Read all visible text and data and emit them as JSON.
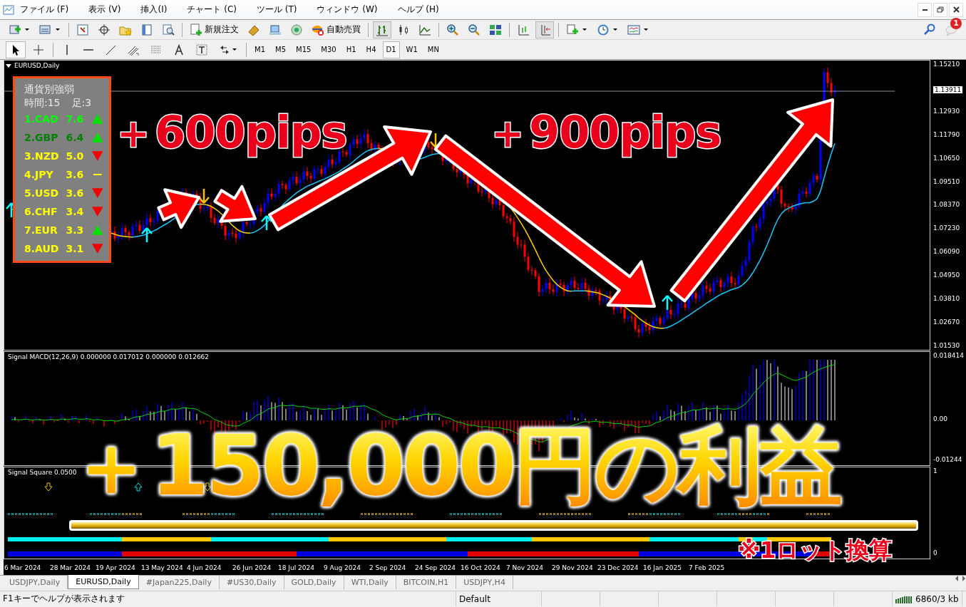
{
  "menu": {
    "items": [
      "ファイル (F)",
      "表示 (V)",
      "挿入(I)",
      "チャート (C)",
      "ツール (T)",
      "ウィンドウ (W)",
      "ヘルプ (H)"
    ]
  },
  "toolbar": {
    "buttons": [
      {
        "label": "新規注文"
      },
      {
        "label": "自動売買"
      }
    ],
    "bar_chart_on": true,
    "autoscroll_on": true,
    "notification_count": "1"
  },
  "drawing_tools": {
    "cursor_selected": true,
    "timeframes": [
      {
        "label": "M1",
        "selected": false
      },
      {
        "label": "M5",
        "selected": false
      },
      {
        "label": "M15",
        "selected": false
      },
      {
        "label": "M30",
        "selected": false
      },
      {
        "label": "H1",
        "selected": false
      },
      {
        "label": "H4",
        "selected": false
      },
      {
        "label": "D1",
        "selected": true
      },
      {
        "label": "W1",
        "selected": false
      },
      {
        "label": "MN",
        "selected": false
      }
    ]
  },
  "chart": {
    "title": "EURUSD,Daily",
    "price_axis": [
      "1.15210",
      "1.12930",
      "1.11790",
      "1.10650",
      "1.09510",
      "1.08370",
      "1.07230",
      "1.06090",
      "1.04950",
      "1.03810",
      "1.02670",
      "1.01530"
    ],
    "current_price": "1.13911",
    "strength": {
      "title": "通貨別強弱",
      "period": "時間:15",
      "bars": "足:3",
      "rows": [
        {
          "label": "1.CAD",
          "value": "7.6",
          "color": "#00ff00",
          "trend": {
            "kind": "up",
            "color": "#00e000"
          }
        },
        {
          "label": "2.GBP",
          "value": "6.4",
          "color": "#008000",
          "trend": {
            "kind": "up",
            "color": "#00e000"
          }
        },
        {
          "label": "3.NZD",
          "value": "5.0",
          "color": "#ffff00",
          "trend": {
            "kind": "down",
            "color": "#f00000"
          }
        },
        {
          "label": "4.JPY",
          "value": "3.6",
          "color": "#ffff00",
          "trend": {
            "kind": "flat",
            "color": "#ffff00"
          }
        },
        {
          "label": "5.USD",
          "value": "3.6",
          "color": "#ffff00",
          "trend": {
            "kind": "down",
            "color": "#f00000"
          }
        },
        {
          "label": "6.CHF",
          "value": "3.4",
          "color": "#ffff00",
          "trend": {
            "kind": "down",
            "color": "#f00000"
          }
        },
        {
          "label": "7.EUR",
          "value": "3.3",
          "color": "#ffff00",
          "trend": {
            "kind": "up",
            "color": "#00e000"
          }
        },
        {
          "label": "8.AUD",
          "value": "3.1",
          "color": "#ffff00",
          "trend": {
            "kind": "down",
            "color": "#f00000"
          }
        }
      ]
    }
  },
  "macd": {
    "label": "Signal MACD(12,26,9) 0.000000 0.017012 0.000000 0.012662",
    "axis": [
      "0.018414",
      "0.00",
      "-0.01244"
    ]
  },
  "square": {
    "label": "Signal Square 0.0500",
    "axis": [
      "1",
      "0"
    ]
  },
  "time_axis": [
    "6 Mar 2024",
    "28 Mar 2024",
    "19 Apr 2024",
    "13 May 2024",
    "4 Jun 2024",
    "26 Jun 2024",
    "18 Jul 2024",
    "9 Aug 2024",
    "2 Sep 2024",
    "24 Sep 2024",
    "16 Oct 2024",
    "7 Nov 2024",
    "29 Nov 2024",
    "23 Dec 2024",
    "16 Jan 2025",
    "7 Feb 2025"
  ],
  "overlay": {
    "gain_1": "＋600pips",
    "gain_2": "＋900pips",
    "profit": "＋150,000円の利益",
    "note": "※1ロット換算"
  },
  "tabs": [
    {
      "label": "USDJPY,Daily",
      "selected": false
    },
    {
      "label": "EURUSD,Daily",
      "selected": true
    },
    {
      "label": "#Japan225,Daily",
      "selected": false
    },
    {
      "label": "#US30,Daily",
      "selected": false
    },
    {
      "label": "GOLD,Daily",
      "selected": false
    },
    {
      "label": "WTI,Daily",
      "selected": false
    },
    {
      "label": "BITCOIN,H1",
      "selected": false
    },
    {
      "label": "USDJPY,H4",
      "selected": false
    }
  ],
  "status_bar": {
    "help": "F1キーでヘルプが表示されます",
    "profile": "Default",
    "traffic": "6860/3 kb"
  }
}
